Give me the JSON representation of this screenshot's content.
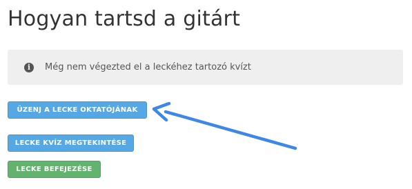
{
  "lesson": {
    "title": "Hogyan tartsd a gitárt"
  },
  "notice": {
    "icon": "info-icon",
    "icon_glyph": "i",
    "text": "Még nem végezted el a leckéhez tartozó kvízt"
  },
  "actions": {
    "message_teacher": "ÜZENJ A LECKE OKTATÓJÁNAK",
    "view_quiz": "LECKE KVÍZ MEGTEKINTÉSE",
    "complete_lesson": "LECKE BEFEJEZÉSE"
  },
  "colors": {
    "blue": "#55a8e3",
    "green": "#63b26e",
    "arrow": "#3d87e8"
  }
}
